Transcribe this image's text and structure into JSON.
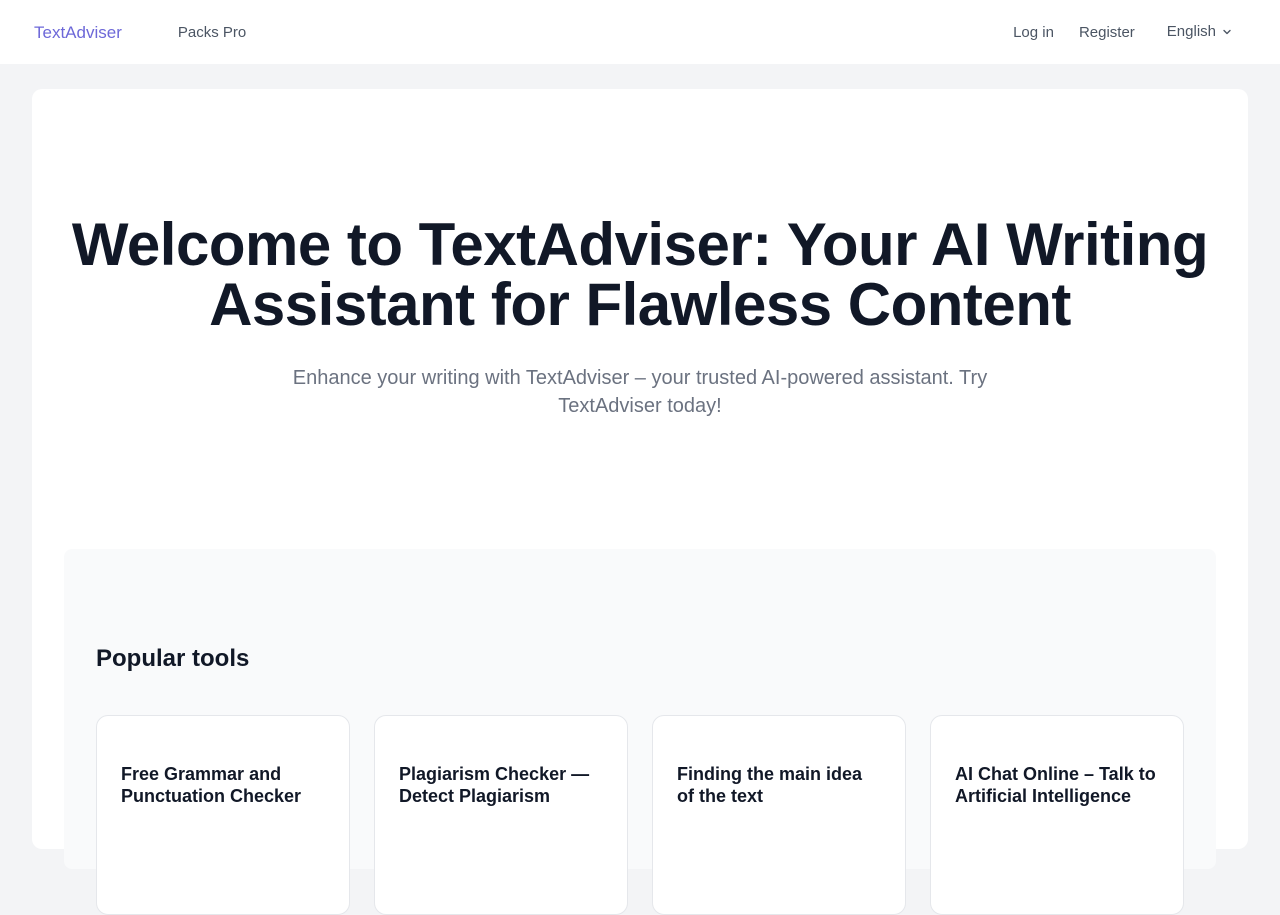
{
  "header": {
    "logo": "TextAdviser",
    "nav_packs": "Packs Pro",
    "login": "Log in",
    "register": "Register",
    "language": "English"
  },
  "hero": {
    "title": "Welcome to TextAdviser: Your AI Writing Assistant for Flawless Content",
    "subtitle": "Enhance your writing with TextAdviser – your trusted AI-powered assistant. Try TextAdviser today!"
  },
  "popular_tools": {
    "heading": "Popular tools",
    "items": [
      {
        "title": "Free Grammar and Punctuation Checker"
      },
      {
        "title": "Plagiarism Checker — Detect Plagiarism"
      },
      {
        "title": "Finding the main idea of the text"
      },
      {
        "title": "AI Chat Online – Talk to Artificial Intelligence"
      }
    ]
  },
  "colors": {
    "brand": "#6d68d8",
    "page_bg": "#f3f4f6",
    "text_dark": "#111827",
    "text_muted": "#6b7280"
  }
}
